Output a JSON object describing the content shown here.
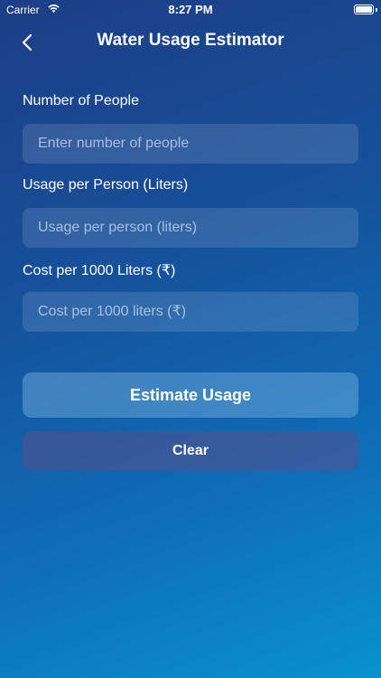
{
  "status_bar": {
    "carrier": "Carrier",
    "time": "8:27 PM"
  },
  "nav": {
    "title": "Water Usage Estimator",
    "back_icon": "chevron-left-icon"
  },
  "form": {
    "people": {
      "label": "Number of People",
      "placeholder": "Enter number of people",
      "value": ""
    },
    "usage": {
      "label": "Usage per Person (Liters)",
      "placeholder": "Usage per person (liters)",
      "value": ""
    },
    "cost": {
      "label": "Cost per 1000 Liters (₹)",
      "placeholder": "Cost per 1000 liters (₹)",
      "value": ""
    }
  },
  "buttons": {
    "estimate_label": "Estimate Usage",
    "clear_label": "Clear"
  },
  "colors": {
    "gradient_start": "#1d3e86",
    "gradient_end": "#0893cc",
    "text": "#ffffff"
  }
}
